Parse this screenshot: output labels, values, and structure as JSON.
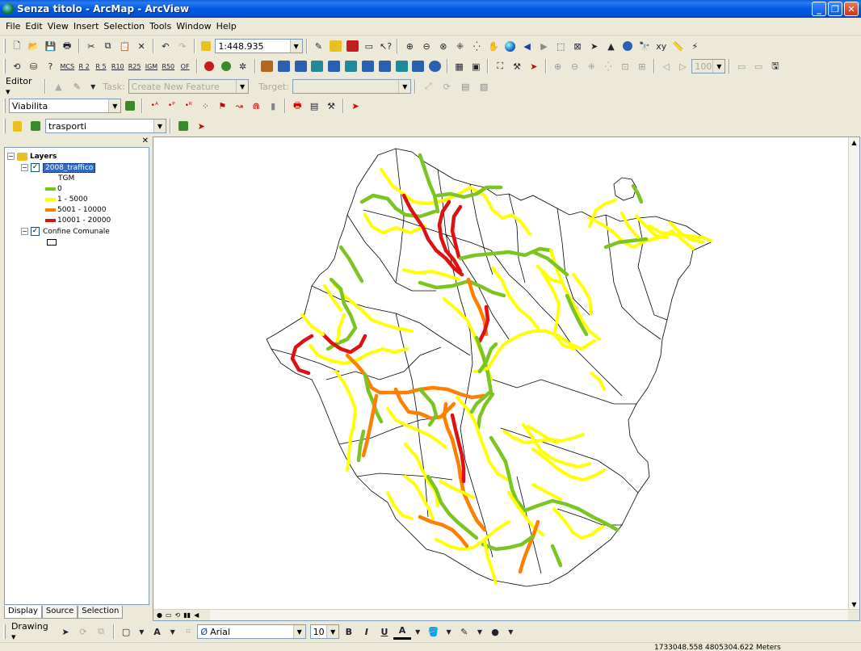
{
  "window": {
    "title": "Senza titolo - ArcMap - ArcView"
  },
  "menu": [
    "File",
    "Edit",
    "View",
    "Insert",
    "Selection",
    "Tools",
    "Window",
    "Help"
  ],
  "standard_toolbar": {
    "scale": "1:448.935"
  },
  "cartography_toolbar": {
    "buttons": [
      "MCS",
      "R 2",
      "R 5",
      "R10",
      "R25",
      "IGM",
      "R50",
      "OF"
    ],
    "zoom": "100%"
  },
  "editor_toolbar": {
    "editor_label": "Editor",
    "task_label": "Task:",
    "task_value": "Create New Feature",
    "target_label": "Target:",
    "target_value": ""
  },
  "network_toolbar": {
    "layer": "Viabilita"
  },
  "thematic_toolbar": {
    "layer": "trasporti"
  },
  "toc": {
    "root": "Layers",
    "layer1": "2008_traffico",
    "field": "TGM",
    "classes": [
      {
        "label": "0",
        "color": "#7cc421"
      },
      {
        "label": "1 - 5000",
        "color": "#ffff00"
      },
      {
        "label": "5001 - 10000",
        "color": "#ff7f00"
      },
      {
        "label": "10001 - 20000",
        "color": "#e01010"
      }
    ],
    "layer2": "Confine Comunale",
    "tabs": [
      "Display",
      "Source",
      "Selection"
    ]
  },
  "drawing_toolbar": {
    "label": "Drawing",
    "font": "Arial",
    "size": "10"
  },
  "status": {
    "coords": "1733048.558  4805304.622 Meters"
  },
  "colors": {
    "green": "#7cc421",
    "yellow": "#ffff00",
    "orange": "#ff7f00",
    "red": "#e01010",
    "boundary": "#000000"
  }
}
